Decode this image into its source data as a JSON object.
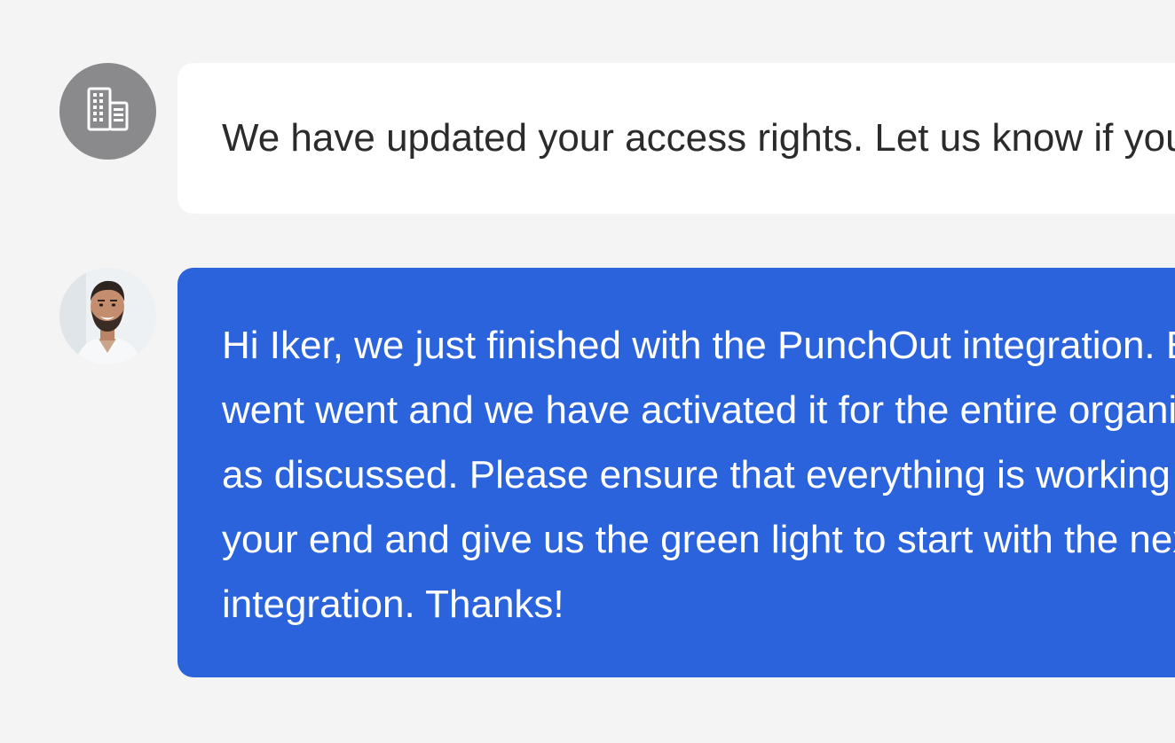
{
  "messages": [
    {
      "sender": "company",
      "avatar_icon": "building-icon",
      "text": "We have updated your access rights. Let us know if you have any questions."
    },
    {
      "sender": "user",
      "avatar_icon": "user-photo",
      "lines": [
        "Hi Iker, we just finished with the PunchOut integration. Everything",
        "went went and we have activated it for the entire organization",
        "as discussed. Please ensure that everything is working on",
        "your end and give us the green light to start with the next",
        "integration. Thanks!"
      ]
    }
  ],
  "colors": {
    "background": "#f4f4f4",
    "incoming_bubble": "#ffffff",
    "outgoing_bubble": "#2a63dc",
    "company_avatar": "#8a8a8c"
  }
}
